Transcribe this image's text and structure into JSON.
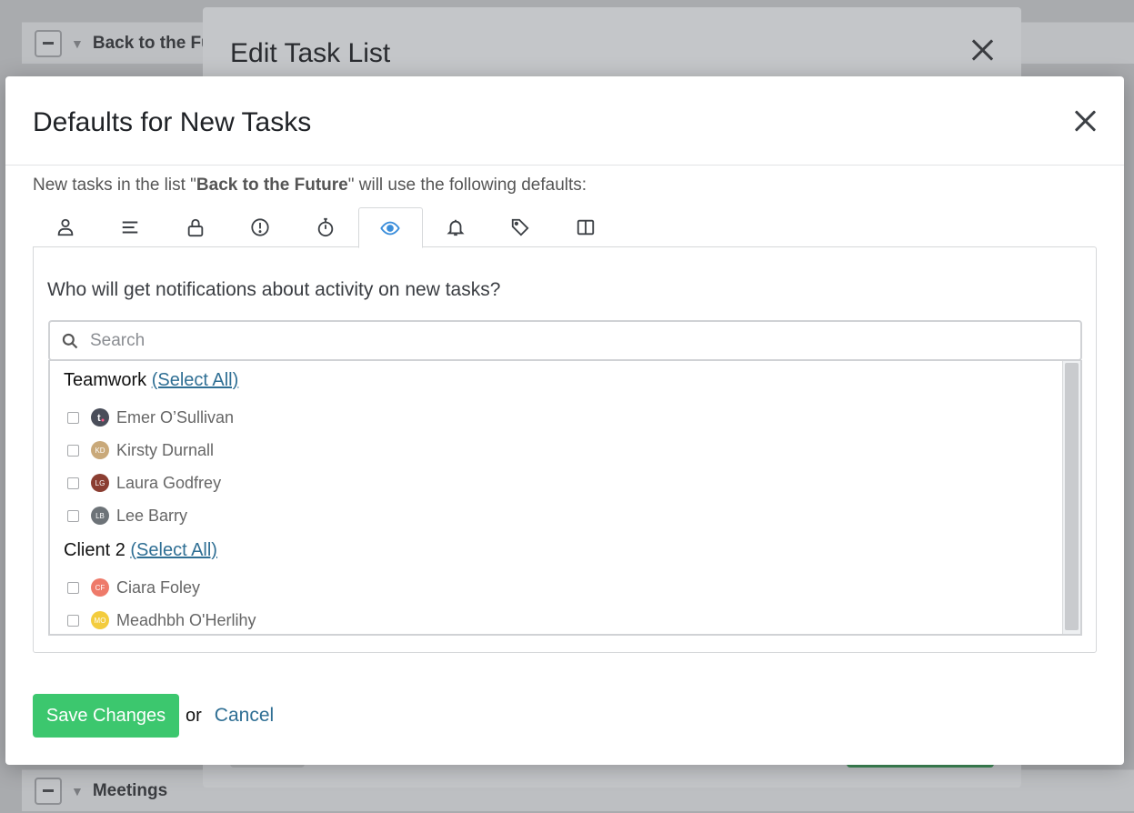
{
  "background": {
    "rows": [
      {
        "title": "Back to the Future"
      },
      {
        "title": "Meetings"
      }
    ],
    "modal_title": "Edit Task List"
  },
  "modal": {
    "title": "Defaults for New Tasks",
    "intro_prefix": "New tasks in the list \"",
    "list_name": "Back to the Future",
    "intro_suffix": "\" will use the following defaults:",
    "tabs": [
      {
        "icon": "person-icon"
      },
      {
        "icon": "description-icon"
      },
      {
        "icon": "lock-icon"
      },
      {
        "icon": "priority-icon"
      },
      {
        "icon": "timer-icon"
      },
      {
        "icon": "eye-icon",
        "active": true
      },
      {
        "icon": "bell-icon"
      },
      {
        "icon": "tag-icon"
      },
      {
        "icon": "columns-icon"
      }
    ],
    "question": "Who will get notifications about activity on new tasks?",
    "search": {
      "placeholder": "Search"
    },
    "groups": [
      {
        "name": "Teamwork",
        "select_all": "(Select All)",
        "people": [
          {
            "name": "Emer O’Sullivan",
            "initials": "",
            "color": "#4a4e5a"
          },
          {
            "name": "Kirsty Durnall",
            "initials": "KD",
            "color": "#c9a97a"
          },
          {
            "name": "Laura Godfrey",
            "initials": "LG",
            "color": "#8b3e32"
          },
          {
            "name": "Lee Barry",
            "initials": "LB",
            "color": "#6d7378"
          }
        ]
      },
      {
        "name": "Client 2",
        "select_all": "(Select All)",
        "people": [
          {
            "name": "Ciara Foley",
            "initials": "CF",
            "color": "#ee7a6a"
          },
          {
            "name": "Meadhbh O'Herlihy",
            "initials": "MO",
            "color": "#f3cc3e"
          }
        ]
      }
    ],
    "footer": {
      "save_label": "Save Changes",
      "or_text": "or",
      "cancel_label": "Cancel"
    }
  },
  "colors": {
    "accent_blue": "#3b8edb",
    "save_green": "#3cc76e",
    "link": "#2f6f94"
  }
}
